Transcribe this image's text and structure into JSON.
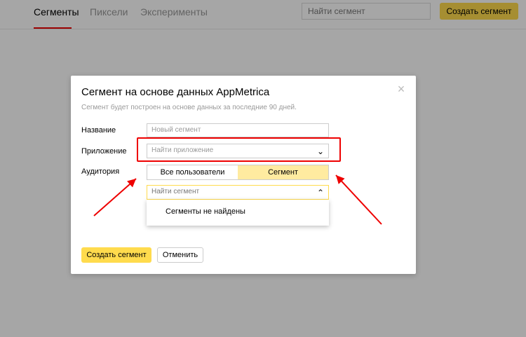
{
  "topbar": {
    "tabs": [
      {
        "label": "Сегменты",
        "active": true
      },
      {
        "label": "Пиксели",
        "active": false
      },
      {
        "label": "Эксперименты",
        "active": false
      }
    ],
    "search_placeholder": "Найти сегмент",
    "create_label": "Создать сегмент"
  },
  "modal": {
    "title": "Сегмент на основе данных AppMetrica",
    "subtitle": "Сегмент будет построен на основе данных за последние 90 дней.",
    "name_label": "Название",
    "name_placeholder": "Новый сегмент",
    "app_label": "Приложение",
    "app_placeholder": "Найти приложение",
    "audience_label": "Аудитория",
    "audience_options": [
      {
        "label": "Все пользователи",
        "active": false
      },
      {
        "label": "Сегмент",
        "active": true
      }
    ],
    "segment_search_placeholder": "Найти сегмент",
    "dropdown_empty": "Сегменты не найдены",
    "create_label": "Создать сегмент",
    "cancel_label": "Отменить"
  },
  "colors": {
    "accent": "#ffdb4d",
    "highlight": "#e00000",
    "segment_active": "#ffeba0"
  }
}
